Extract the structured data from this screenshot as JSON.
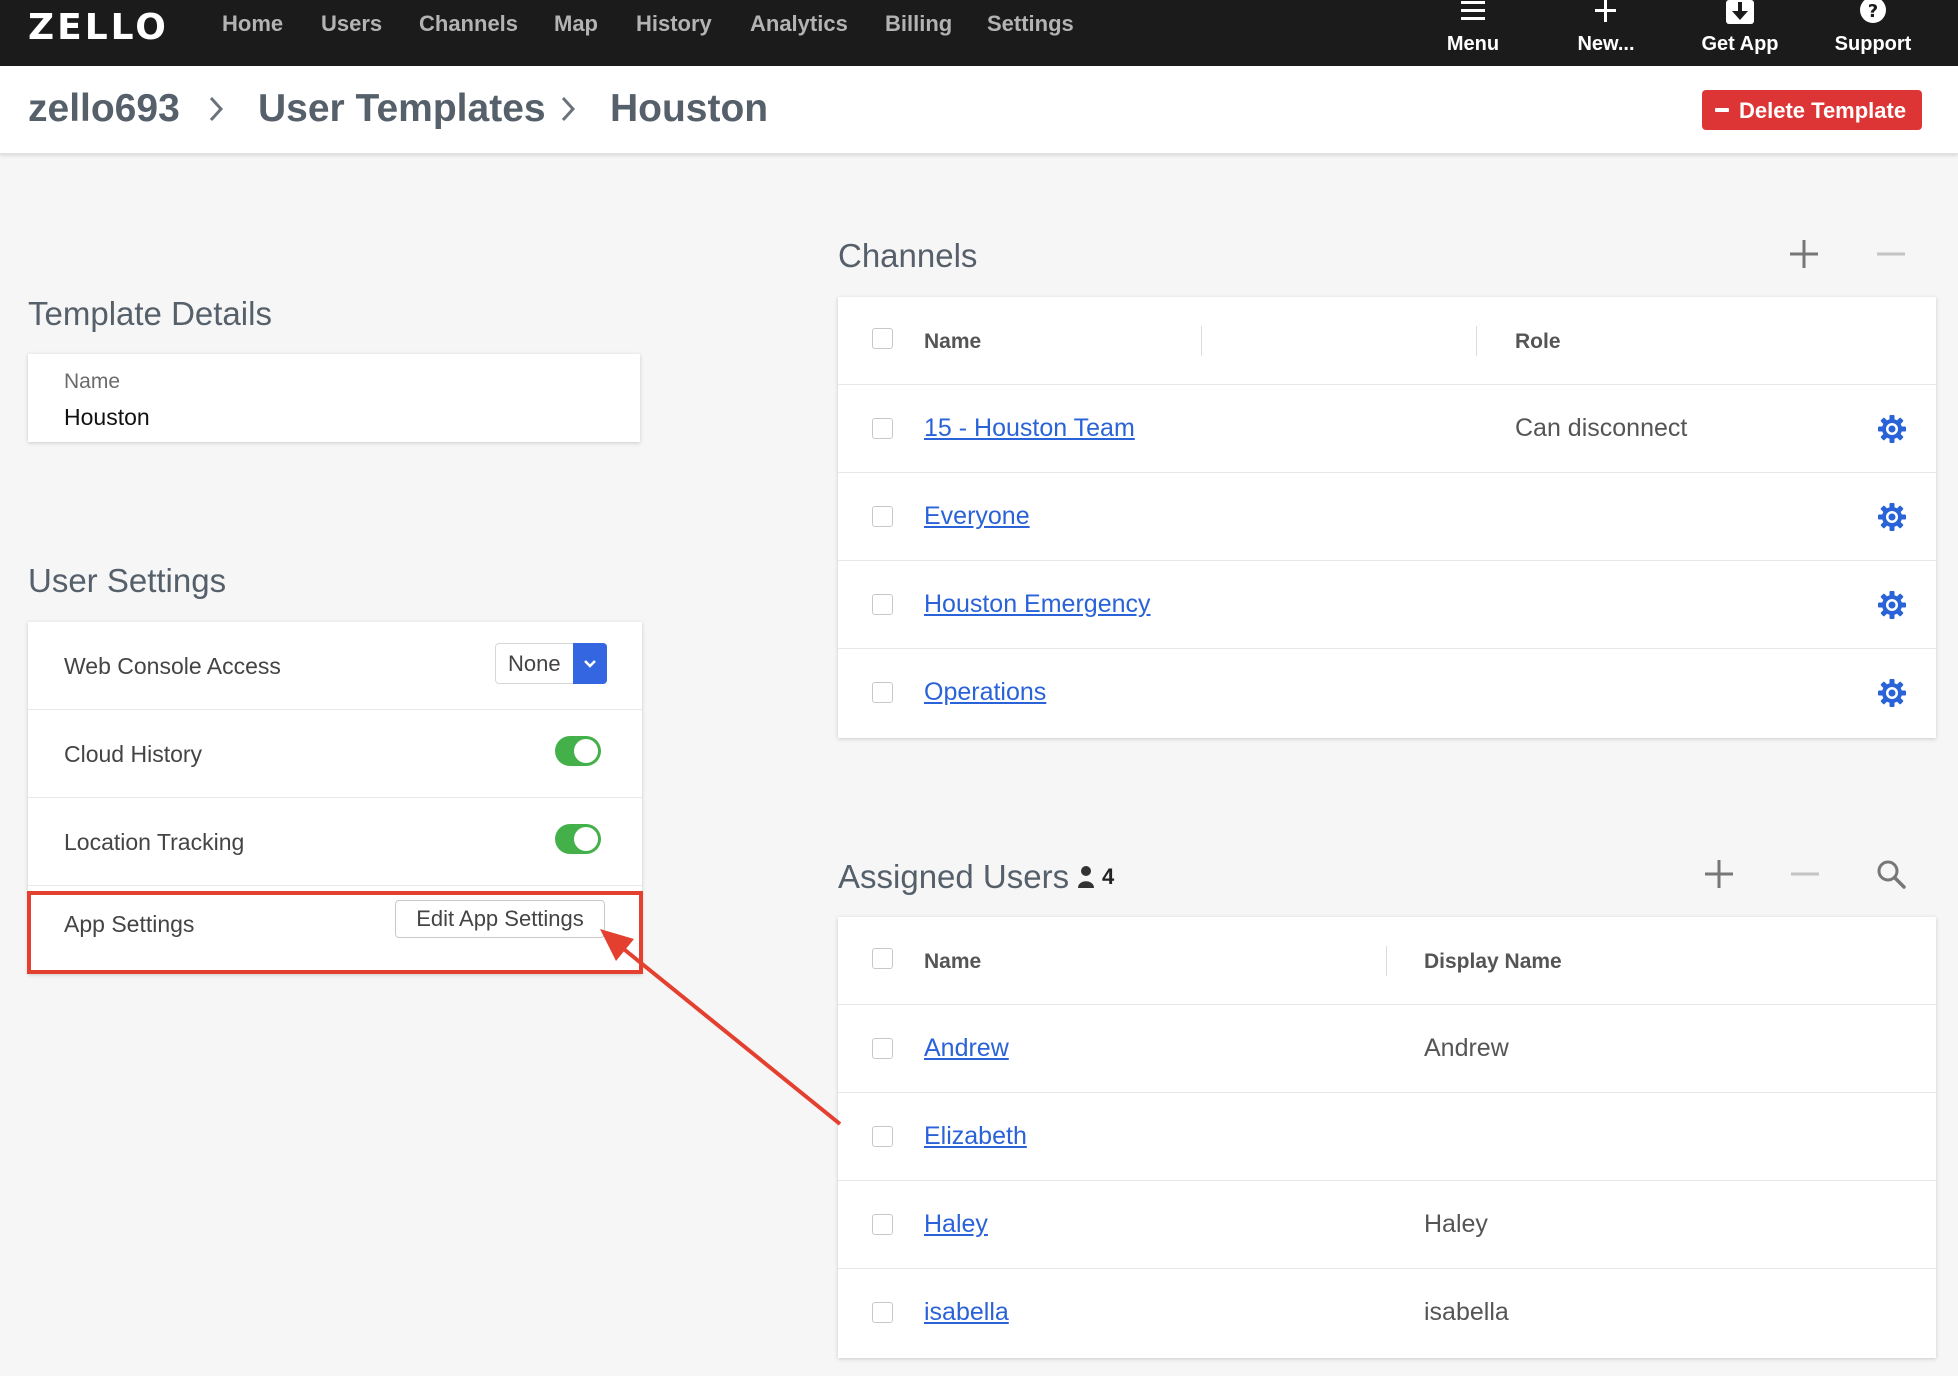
{
  "app": {
    "logo_text": "ZELLO",
    "nav": [
      "Home",
      "Users",
      "Channels",
      "Map",
      "History",
      "Analytics",
      "Billing",
      "Settings"
    ],
    "actions": {
      "menu": "Menu",
      "new": "New...",
      "get_app": "Get App",
      "support": "Support"
    }
  },
  "breadcrumb": {
    "account": "zello693",
    "section": "User Templates",
    "current": "Houston"
  },
  "header": {
    "delete_label": "Delete Template"
  },
  "template_details": {
    "title": "Template Details",
    "name_label": "Name",
    "name_value": "Houston"
  },
  "user_settings": {
    "title": "User Settings",
    "web_console_label": "Web Console Access",
    "web_console_value": "None",
    "cloud_history_label": "Cloud History",
    "cloud_history_on": true,
    "location_label": "Location Tracking",
    "location_on": true,
    "app_settings_label": "App Settings",
    "edit_app_settings": "Edit App Settings"
  },
  "channels": {
    "title": "Channels",
    "col_name": "Name",
    "col_role": "Role",
    "rows": [
      {
        "name": "15 - Houston Team",
        "role": "Can disconnect"
      },
      {
        "name": "Everyone",
        "role": ""
      },
      {
        "name": "Houston Emergency",
        "role": ""
      },
      {
        "name": "Operations",
        "role": ""
      }
    ]
  },
  "assigned_users": {
    "title": "Assigned Users",
    "count": "4",
    "col_name": "Name",
    "col_display": "Display Name",
    "rows": [
      {
        "name": "Andrew",
        "display": "Andrew"
      },
      {
        "name": "Elizabeth",
        "display": ""
      },
      {
        "name": "Haley",
        "display": "Haley"
      },
      {
        "name": "isabella",
        "display": "isabella"
      }
    ]
  },
  "colors": {
    "topbar": "#1b1b1b",
    "accent_blue": "#3366e0",
    "link": "#2a62d8",
    "danger": "#dd3535",
    "toggle_on": "#43b04a",
    "annotation": "#e4402f"
  }
}
